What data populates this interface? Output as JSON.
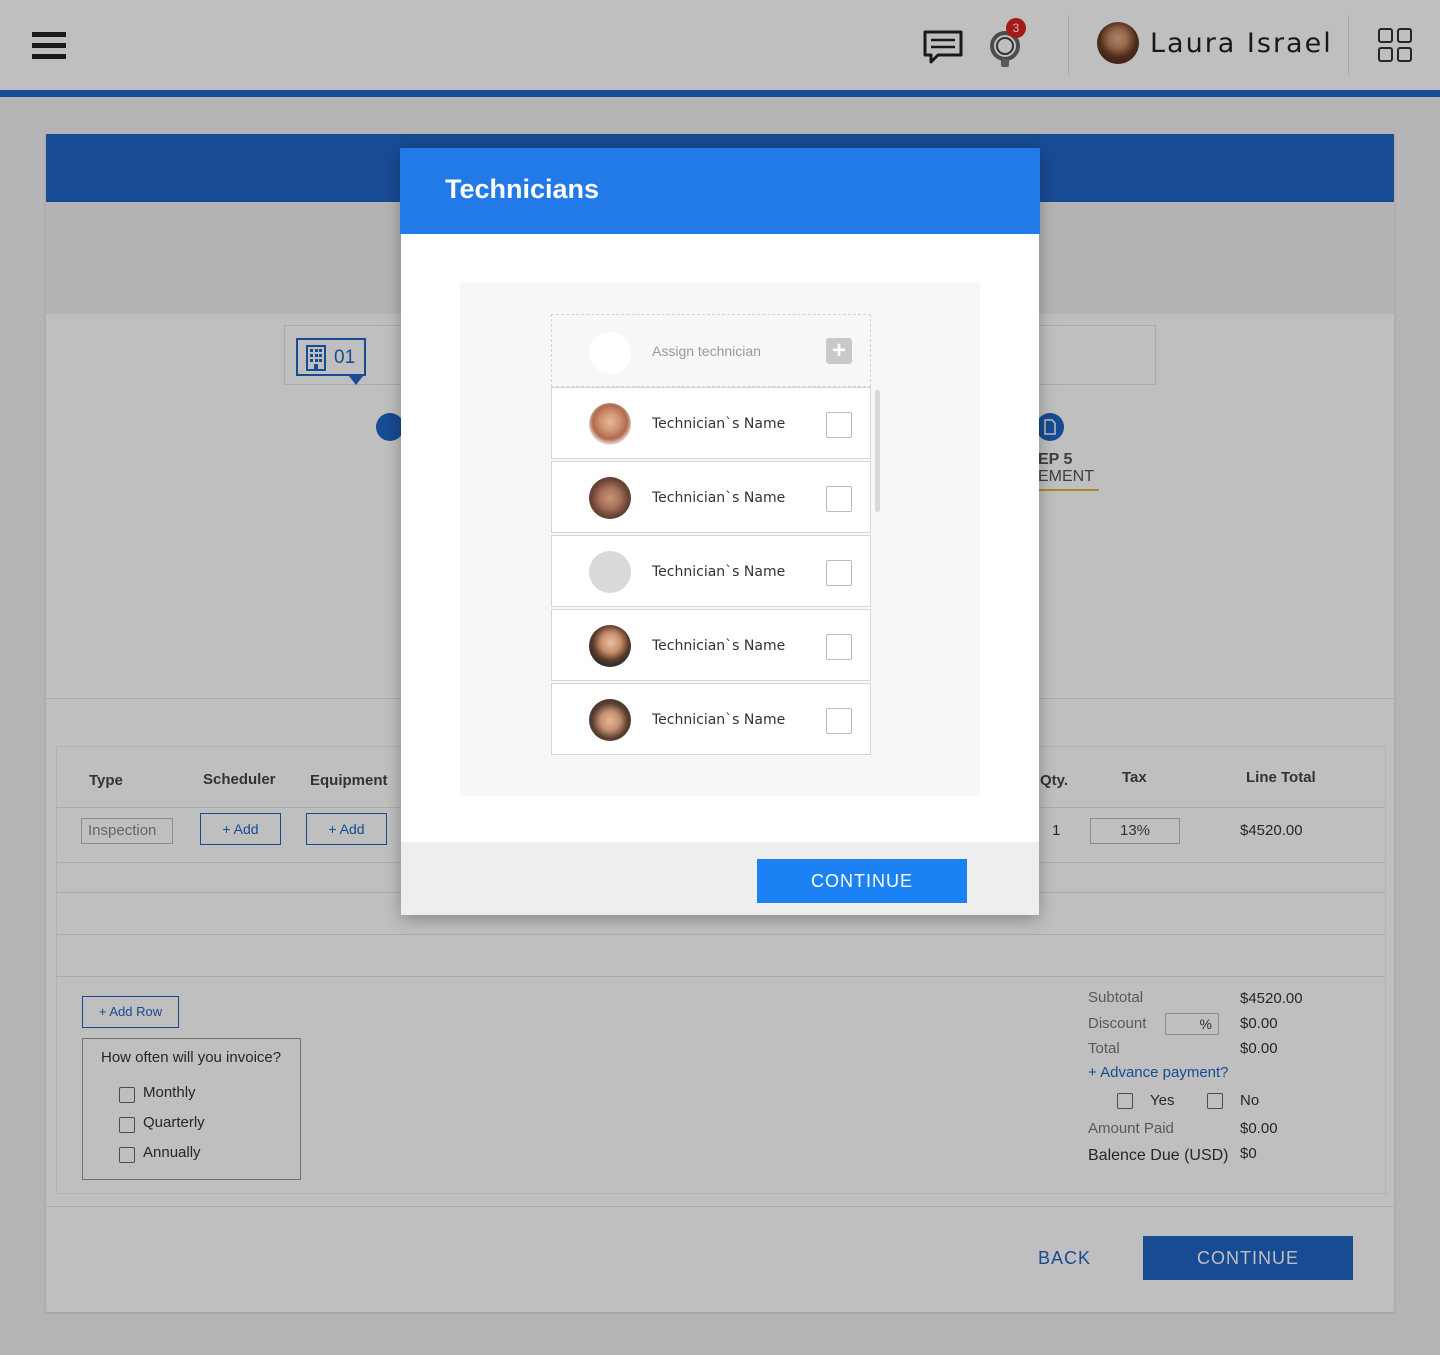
{
  "topbar": {
    "user_name": "Laura Israel",
    "notification_count": "3"
  },
  "background": {
    "step_number": "01",
    "step5_label_line1": "EP 5",
    "step5_label_line2": "EMENT",
    "table": {
      "headers": {
        "type": "Type",
        "scheduler": "Scheduler",
        "equipment": "Equipment",
        "qty": "Qty.",
        "tax": "Tax",
        "line_total": "Line Total"
      },
      "row": {
        "type_value": "Inspection",
        "scheduler_add": "+ Add",
        "equipment_add": "+ Add",
        "qty": "1",
        "tax": "13%",
        "line_total": "$4520.00"
      }
    },
    "add_row_label": "+ Add Row",
    "invoice_frequency": {
      "question": "How often will you invoice?",
      "options": [
        "Monthly",
        "Quarterly",
        "Annually"
      ]
    },
    "summary": {
      "subtotal_label": "Subtotal",
      "subtotal_value": "$4520.00",
      "discount_label": "Discount",
      "discount_unit": "%",
      "discount_value": "$0.00",
      "total_label": "Total",
      "total_value": "$0.00",
      "advance_payment_link": "+ Advance payment?",
      "yes_label": "Yes",
      "no_label": "No",
      "amount_paid_label": "Amount Paid",
      "amount_paid_value": "$0.00",
      "balance_due_label": "Balence Due (USD)",
      "balance_due_value": "$0"
    },
    "back_label": "BACK",
    "continue_label": "CONTINUE"
  },
  "modal": {
    "title": "Technicians",
    "assign_placeholder": "Assign technician",
    "technicians": [
      {
        "name": "Technician`s Name"
      },
      {
        "name": "Technician`s Name"
      },
      {
        "name": "Technician`s Name"
      },
      {
        "name": "Technician`s Name"
      },
      {
        "name": "Technician`s Name"
      }
    ],
    "continue_label": "CONTINUE"
  },
  "colors": {
    "brand_blue": "#1f65c6",
    "modal_header_blue": "#2279e8",
    "button_blue": "#1c82f4",
    "notification_red": "#dd2222"
  }
}
